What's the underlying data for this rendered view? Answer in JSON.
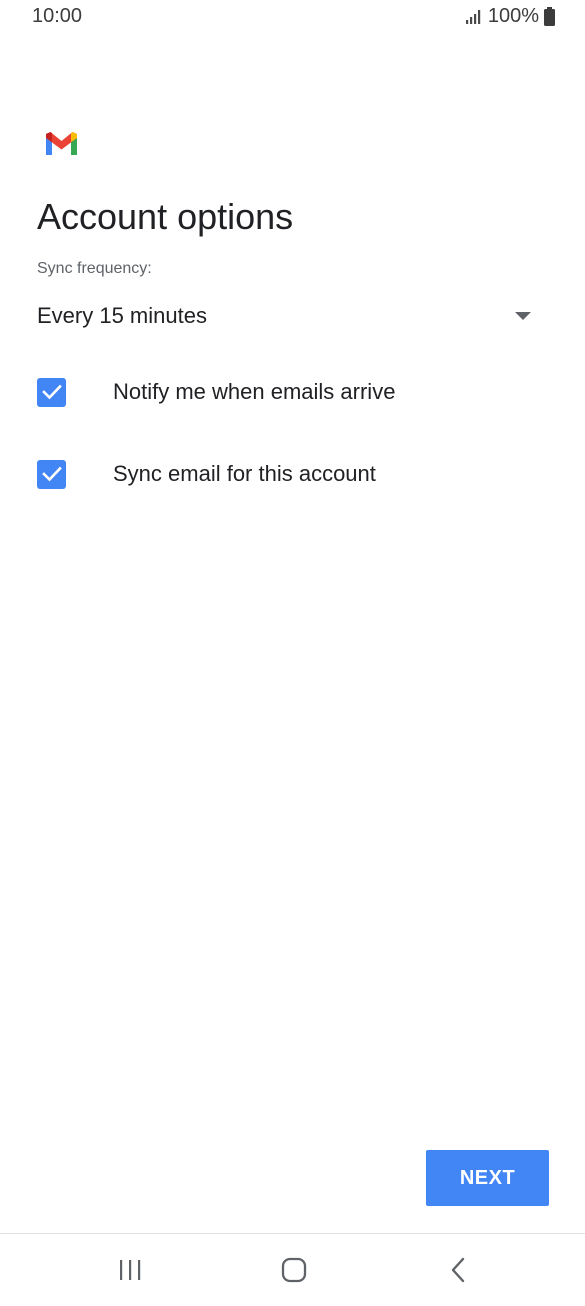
{
  "status_bar": {
    "time": "10:00",
    "battery_text": "100%"
  },
  "app": {
    "logo_icon": "gmail-logo",
    "colors": {
      "accent": "#4285f4",
      "logo_red": "#ea4335",
      "logo_blue": "#4285f4",
      "logo_green": "#34a853",
      "logo_yellow": "#fbbc04"
    }
  },
  "main": {
    "title": "Account options",
    "sync_frequency": {
      "label": "Sync frequency:",
      "selected_value": "Every 15 minutes"
    },
    "options": [
      {
        "label": "Notify me when emails arrive",
        "checked": true
      },
      {
        "label": "Sync email for this account",
        "checked": true
      }
    ],
    "next_label": "NEXT"
  },
  "nav_bar": {
    "icons": [
      "recents-icon",
      "home-icon",
      "back-icon"
    ]
  }
}
